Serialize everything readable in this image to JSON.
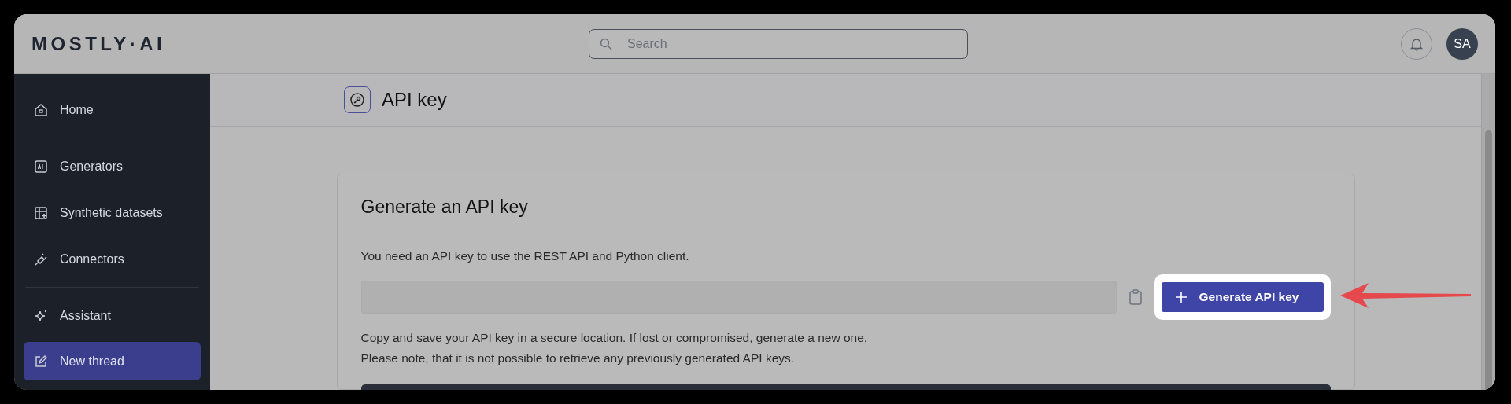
{
  "header": {
    "logo": "MOSTLY·AI",
    "search": {
      "placeholder": "Search"
    },
    "avatar": "SA"
  },
  "sidebar": {
    "groups": [
      {
        "items": [
          {
            "label": "Home",
            "kind": "link"
          }
        ]
      },
      {
        "items": [
          {
            "label": "Generators",
            "kind": "link"
          },
          {
            "label": "Synthetic datasets",
            "kind": "link"
          },
          {
            "label": "Connectors",
            "kind": "link"
          }
        ]
      },
      {
        "items": [
          {
            "label": "Assistant",
            "kind": "link"
          },
          {
            "label": "New thread",
            "kind": "button"
          }
        ]
      }
    ]
  },
  "page": {
    "title": "API key"
  },
  "card": {
    "heading": "Generate an API key",
    "intro": "You need an API key to use the REST API and Python client.",
    "button": "Generate API key",
    "notes": [
      "Copy and save your API key in a secure location. If lost or compromised, generate a new one.",
      "Please note, that it is not possible to retrieve any previously generated API keys."
    ]
  }
}
